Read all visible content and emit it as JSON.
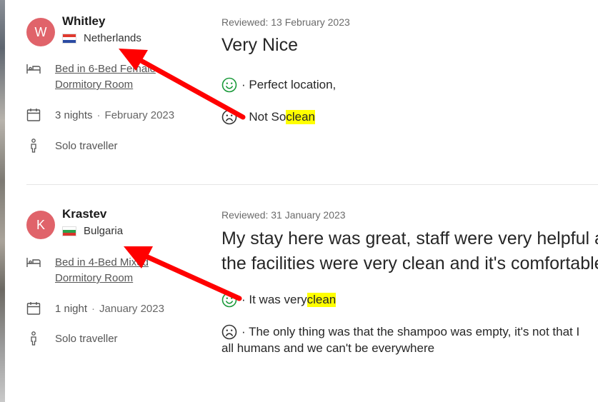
{
  "colors": {
    "avatar_bg": "#e0636a",
    "highlight": "#ffff00",
    "annotation_arrow": "#ff0000"
  },
  "reviews": [
    {
      "avatar_letter": "W",
      "name": "Whitley",
      "country": "Netherlands",
      "room_line1": "Bed in 6-Bed Female",
      "room_line2": "Dormitory Room",
      "nights": "3 nights",
      "sep": "·",
      "stay_date": "February 2023",
      "traveller": "Solo traveller",
      "reviewed": "Reviewed: 13 February 2023",
      "title": "Very Nice",
      "positive_prefix": "· Perfect location,",
      "negative_prefix": "· Not So ",
      "negative_highlight": "clean"
    },
    {
      "avatar_letter": "K",
      "name": "Krastev",
      "country": "Bulgaria",
      "room_line1": "Bed in 4-Bed Mixed",
      "room_line2": "Dormitory Room",
      "nights": "1 night",
      "sep": "·",
      "stay_date": "January 2023",
      "traveller": "Solo traveller",
      "reviewed": "Reviewed: 31 January 2023",
      "title_line1": "My stay here was great, staff were very helpful and",
      "title_line2": "the facilities were very clean and it's comfortable",
      "positive_prefix": "· It was very ",
      "positive_highlight": "clean",
      "negative_line1": "· The only thing was that the shampoo was empty, it's not that I",
      "negative_line2": "all humans and we can't be everywhere"
    }
  ]
}
